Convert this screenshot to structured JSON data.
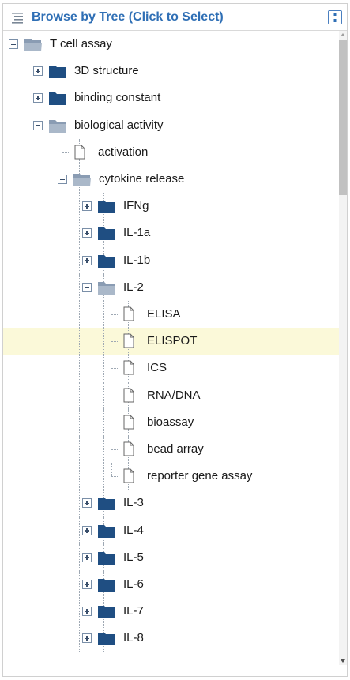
{
  "header": {
    "title": "Browse by Tree (Click to Select)"
  },
  "tree": {
    "nodes": [
      {
        "label": "T cell assay",
        "level": 0,
        "kind": "folder",
        "state": "open"
      },
      {
        "label": "3D structure",
        "level": 1,
        "kind": "folder",
        "state": "closed"
      },
      {
        "label": "binding constant",
        "level": 1,
        "kind": "folder",
        "state": "closed"
      },
      {
        "label": "biological activity",
        "level": 1,
        "kind": "folder",
        "state": "open"
      },
      {
        "label": "activation",
        "level": 2,
        "kind": "leaf"
      },
      {
        "label": "cytokine release",
        "level": 2,
        "kind": "folder",
        "state": "open"
      },
      {
        "label": "IFNg",
        "level": 3,
        "kind": "folder",
        "state": "closed"
      },
      {
        "label": "IL-1a",
        "level": 3,
        "kind": "folder",
        "state": "closed"
      },
      {
        "label": "IL-1b",
        "level": 3,
        "kind": "folder",
        "state": "closed"
      },
      {
        "label": "IL-2",
        "level": 3,
        "kind": "folder",
        "state": "open"
      },
      {
        "label": "ELISA",
        "level": 4,
        "kind": "leaf"
      },
      {
        "label": "ELISPOT",
        "level": 4,
        "kind": "leaf",
        "selected": true
      },
      {
        "label": "ICS",
        "level": 4,
        "kind": "leaf"
      },
      {
        "label": "RNA/DNA",
        "level": 4,
        "kind": "leaf"
      },
      {
        "label": "bioassay",
        "level": 4,
        "kind": "leaf"
      },
      {
        "label": "bead array",
        "level": 4,
        "kind": "leaf"
      },
      {
        "label": "reporter gene assay",
        "level": 4,
        "kind": "leaf",
        "last": true
      },
      {
        "label": "IL-3",
        "level": 3,
        "kind": "folder",
        "state": "closed"
      },
      {
        "label": "IL-4",
        "level": 3,
        "kind": "folder",
        "state": "closed"
      },
      {
        "label": "IL-5",
        "level": 3,
        "kind": "folder",
        "state": "closed"
      },
      {
        "label": "IL-6",
        "level": 3,
        "kind": "folder",
        "state": "closed"
      },
      {
        "label": "IL-7",
        "level": 3,
        "kind": "folder",
        "state": "closed"
      },
      {
        "label": "IL-8",
        "level": 3,
        "kind": "folder",
        "state": "closed"
      }
    ]
  },
  "colors": {
    "title": "#2f6fb5",
    "folder_closed": "#1f4e82",
    "folder_open": "#8a9cb3",
    "selected_row": "#fbf9d9"
  }
}
